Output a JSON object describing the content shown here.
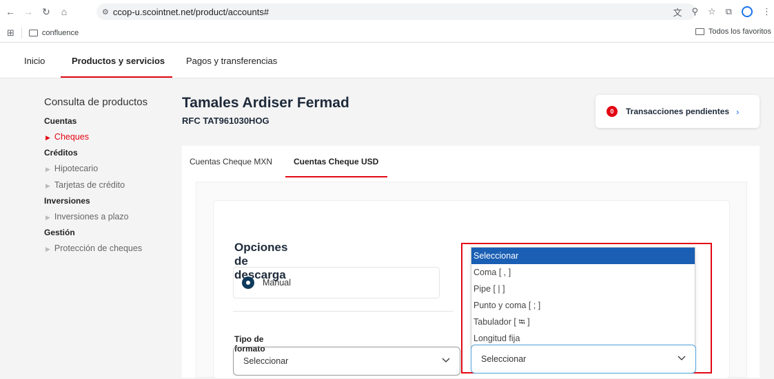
{
  "browser": {
    "url": "ccop-u.scointnet.net/product/accounts#",
    "bookmarks": {
      "folder": "confluence",
      "all_bookmarks": "Todos los favoritos"
    }
  },
  "site_nav": {
    "items": [
      {
        "label": "Inicio"
      },
      {
        "label": "Productos y servicios"
      },
      {
        "label": "Pagos y transferencias"
      }
    ]
  },
  "sidebar": {
    "title": "Consulta de productos",
    "sections": [
      {
        "label": "Cuentas",
        "items": [
          "Cheques"
        ]
      },
      {
        "label": "Créditos",
        "items": [
          "Hipotecario",
          "Tarjetas de crédito"
        ]
      },
      {
        "label": "Inversiones",
        "items": [
          "Inversiones a plazo"
        ]
      },
      {
        "label": "Gestión",
        "items": [
          "Protección de cheques"
        ]
      }
    ]
  },
  "customer": {
    "name": "Tamales Ardiser Fermad",
    "rfc": "RFC TAT961030HOG"
  },
  "pending": {
    "count": "0",
    "label": "Transacciones pendientes"
  },
  "tabs": [
    {
      "label": "Cuentas Cheque MXN"
    },
    {
      "label": "Cuentas Cheque USD"
    }
  ],
  "download": {
    "title": "Opciones de descarga",
    "mode_label": "Manual",
    "format_label": "Tipo de formato",
    "format_select_value": "Seleccionar",
    "separator_select_value": "Seleccionar",
    "separator_options": [
      "Seleccionar",
      "Coma [ , ]",
      "Pipe [ | ]",
      "Punto y coma [ ; ]",
      "Tabulador [ ⭾ ]",
      "Longitud fija"
    ]
  },
  "colors": {
    "brand_red": "#e30613",
    "navy": "#1e2a3a",
    "selected_blue": "#1a5fb4"
  }
}
